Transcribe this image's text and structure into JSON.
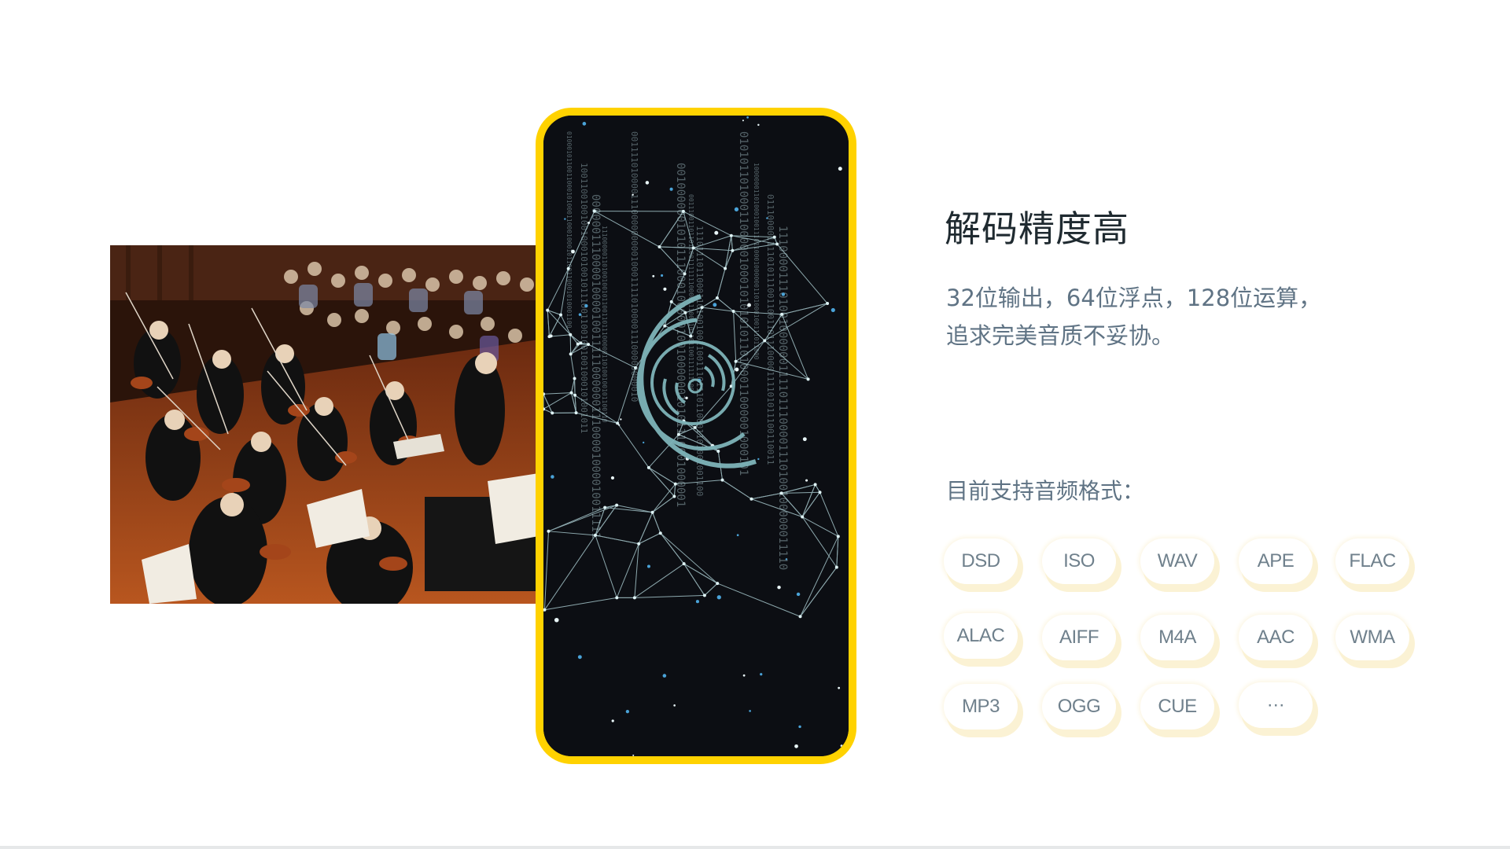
{
  "feature": {
    "title": "解码精度高",
    "description_lines": [
      "32位输出，64位浮点，128位运算，",
      "追求完美音质不妥协。"
    ],
    "formats_label": "目前支持音频格式：",
    "formats": [
      "DSD",
      "ISO",
      "WAV",
      "APE",
      "FLAC",
      "ALAC",
      "AIFF",
      "M4A",
      "AAC",
      "WMA",
      "MP3",
      "OGG",
      "CUE",
      "···"
    ]
  },
  "images": {
    "photo": "orchestra-concert-photo",
    "phone_screen": "digital-audio-network-graphic"
  },
  "colors": {
    "accent": "#ffd200",
    "title": "#1f2a30",
    "body_text": "#5f7384",
    "pill_text": "#6f808c",
    "pill_shadow": "#fbf2d4",
    "phone_bg": "#0c0e13"
  }
}
